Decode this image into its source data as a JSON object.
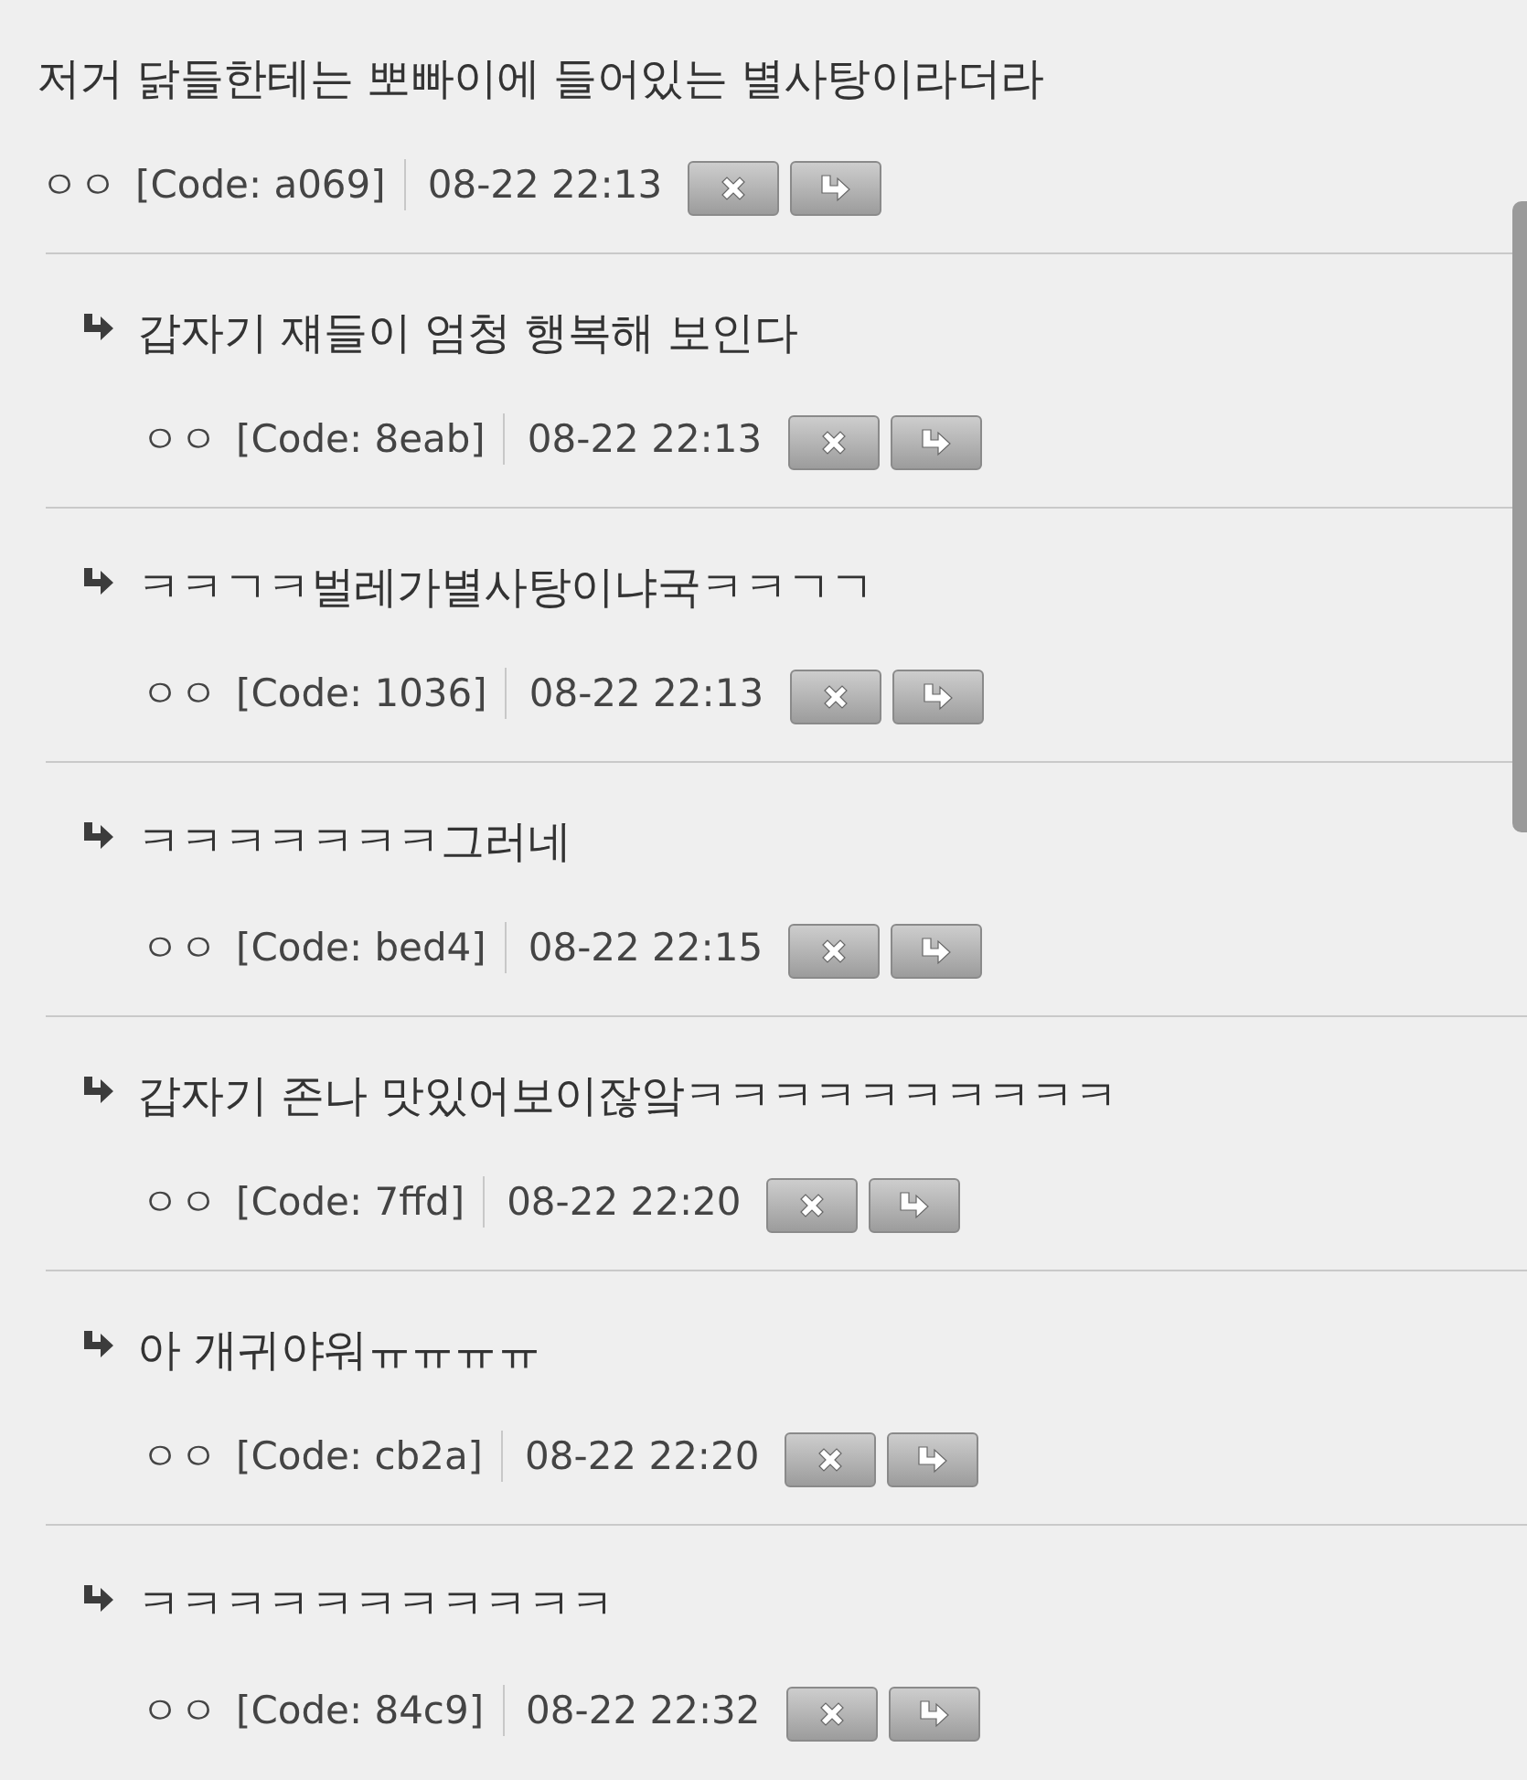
{
  "comment": {
    "text": "저거 닭들한테는 뽀빠이에 들어있는 별사탕이라더라",
    "author": "ㅇㅇ",
    "code": "[Code: a069]",
    "time": "08-22 22:13"
  },
  "replies": [
    {
      "text": "갑자기 쟤들이 엄청 행복해 보인다",
      "author": "ㅇㅇ",
      "code": "[Code: 8eab]",
      "time": "08-22 22:13"
    },
    {
      "text": "ㅋㅋㄱㅋ벌레가별사탕이냐국ㅋㅋㄱㄱ",
      "author": "ㅇㅇ",
      "code": "[Code: 1036]",
      "time": "08-22 22:13"
    },
    {
      "text": "ㅋㅋㅋㅋㅋㅋㅋ그러네",
      "author": "ㅇㅇ",
      "code": "[Code: bed4]",
      "time": "08-22 22:15"
    },
    {
      "text": "갑자기 존나 맛있어보이잖앜ㅋㅋㅋㅋㅋㅋㅋㅋㅋㅋ",
      "author": "ㅇㅇ",
      "code": "[Code: 7ffd]",
      "time": "08-22 22:20"
    },
    {
      "text": "아 개귀야워ㅠㅠㅠㅠ",
      "author": "ㅇㅇ",
      "code": "[Code: cb2a]",
      "time": "08-22 22:20"
    },
    {
      "text": "ㅋㅋㅋㅋㅋㅋㅋㅋㅋㅋㅋ",
      "author": "ㅇㅇ",
      "code": "[Code: 84c9]",
      "time": "08-22 22:32"
    }
  ]
}
